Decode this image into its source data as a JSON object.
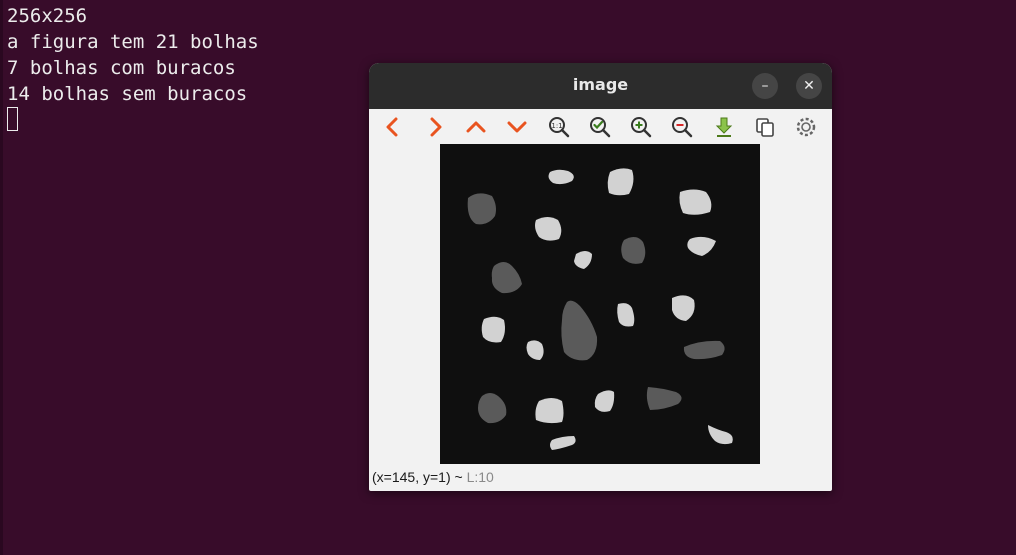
{
  "terminal": {
    "lines": [
      "256x256",
      "a figura tem 21 bolhas",
      "7 bolhas com buracos",
      "14 bolhas sem buracos"
    ]
  },
  "window": {
    "title": "image",
    "minimize_icon": "minimize-icon",
    "close_icon": "close-icon"
  },
  "toolbar": {
    "icons": [
      "pan-left-icon",
      "pan-right-icon",
      "pan-up-icon",
      "pan-down-icon",
      "zoom-original-icon",
      "zoom-fit-icon",
      "zoom-in-icon",
      "zoom-out-icon",
      "save-icon",
      "copy-icon",
      "properties-icon"
    ],
    "accent_orange": "#e95420",
    "accent_green": "#3a7d1e"
  },
  "image": {
    "background": "#0f0f0f",
    "light_blob": "#d2d2d2",
    "dark_blob": "#5a5a5a"
  },
  "status": {
    "coords": "(x=145, y=1) ~",
    "level": "L:10"
  }
}
